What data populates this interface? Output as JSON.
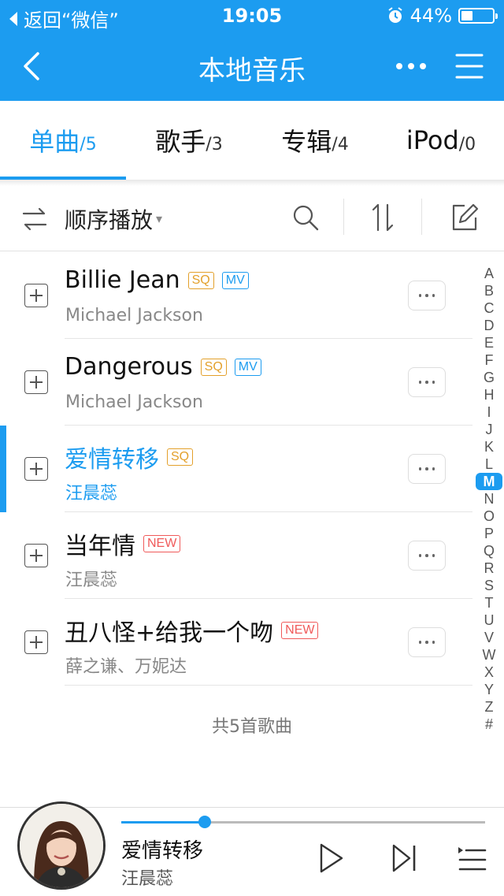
{
  "status_bar": {
    "back_text": "返回“微信”",
    "time": "19:05",
    "battery_text": "44%",
    "battery_level": 0.44,
    "icons": [
      "back-arrow-icon",
      "alarm-icon",
      "battery-icon"
    ]
  },
  "nav": {
    "title": "本地音乐",
    "icons": [
      "back-chevron-icon",
      "more-dots-icon",
      "menu-icon"
    ]
  },
  "tabs": [
    {
      "name": "单曲",
      "count": "/5"
    },
    {
      "name": "歌手",
      "count": "/3"
    },
    {
      "name": "专辑",
      "count": "/4"
    },
    {
      "name": "iPod",
      "count": "/0"
    }
  ],
  "active_tab": 0,
  "toolbar": {
    "play_mode_label": "顺序播放",
    "icons": [
      "sequential-play-icon",
      "search-icon",
      "sort-icon",
      "edit-icon"
    ]
  },
  "songs": [
    {
      "title": "Billie Jean",
      "artist": "Michael Jackson",
      "tags": [
        "SQ",
        "MV"
      ]
    },
    {
      "title": "Dangerous",
      "artist": "Michael Jackson",
      "tags": [
        "SQ",
        "MV"
      ]
    },
    {
      "title": "爱情转移",
      "artist": "汪晨蕊",
      "tags": [
        "SQ"
      ]
    },
    {
      "title": "当年情",
      "artist": "汪晨蕊",
      "tags": [
        "NEW"
      ]
    },
    {
      "title": "丑八怪+给我一个吻",
      "artist": "薛之谦、万妮达",
      "tags": [
        "NEW"
      ]
    }
  ],
  "active_song": 2,
  "index_letters": [
    "A",
    "B",
    "C",
    "D",
    "E",
    "F",
    "G",
    "H",
    "I",
    "J",
    "K",
    "L",
    "M",
    "N",
    "O",
    "P",
    "Q",
    "R",
    "S",
    "T",
    "U",
    "V",
    "W",
    "X",
    "Y",
    "Z",
    "#"
  ],
  "index_selected": "M",
  "footer_count": "共5首歌曲",
  "now_playing": {
    "title": "爱情转移",
    "artist": "汪晨蕊",
    "progress": 0.23,
    "icons": [
      "album-avatar",
      "play-icon",
      "next-icon",
      "playlist-icon"
    ]
  },
  "colors": {
    "accent": "#1c9cf0",
    "sq_tag": "#e3a02b",
    "new_tag": "#f05a5a"
  }
}
